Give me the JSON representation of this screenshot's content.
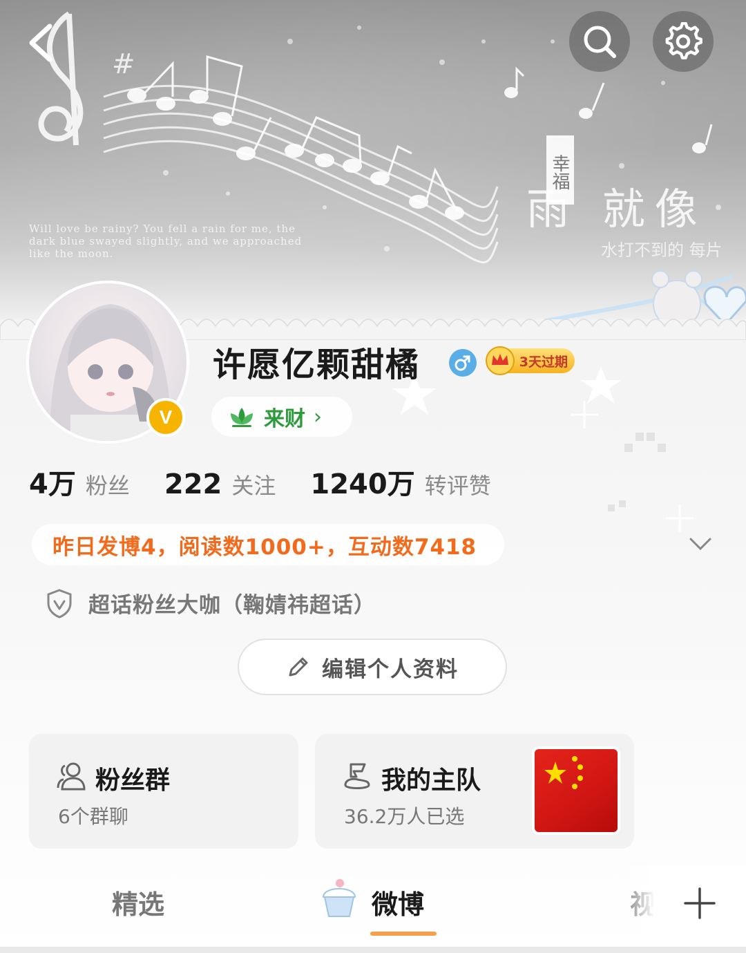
{
  "banner": {
    "caption": "Will love be rainy? You fell a rain for me, the dark blue swayed slightly, and we approached like the moon.",
    "tag": "幸福",
    "big_text": "雨 就像",
    "small_text": "水打不到的 每片"
  },
  "header": {
    "back_icon": "chevron-left-icon",
    "search_icon": "search-icon",
    "settings_icon": "gear-icon"
  },
  "profile": {
    "username": "许愿亿颗甜橘",
    "gender": "male",
    "vip_badge": "V",
    "expire_badge": "3天过期",
    "laicai_label": "来财",
    "laicai_chevron": "›"
  },
  "stats": [
    {
      "value": "4万",
      "label": "粉丝"
    },
    {
      "value": "222",
      "label": "关注"
    },
    {
      "value": "1240万",
      "label": "转评赞"
    }
  ],
  "activity": {
    "text": "昨日发博4，阅读数1000+，互动数7418"
  },
  "superfan": {
    "text": "超话粉丝大咖（鞠婧祎超话）"
  },
  "edit_profile": {
    "label": "编辑个人资料"
  },
  "cards": {
    "fans_group": {
      "title": "粉丝群",
      "subtitle": "6个群聊"
    },
    "my_team": {
      "title": "我的主队",
      "subtitle": "36.2万人已选"
    }
  },
  "tabs": [
    {
      "label": "精选",
      "active": false
    },
    {
      "label": "微博",
      "active": true
    },
    {
      "label": "视频",
      "active": false
    }
  ],
  "colors": {
    "accent_orange": "#f26a1b",
    "laicai_green": "#2d9a3c",
    "vip_gold": "#f6b400",
    "gender_blue": "#5aaee8",
    "flag_red": "#d01612"
  }
}
